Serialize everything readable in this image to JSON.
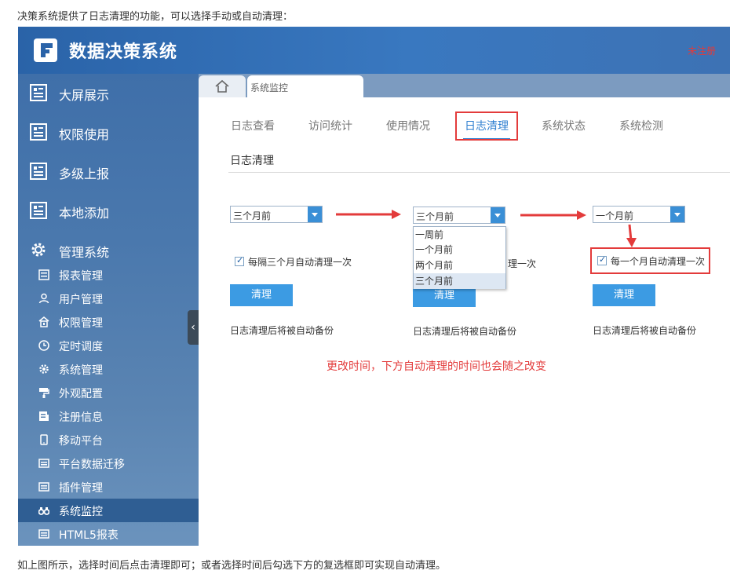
{
  "captions": {
    "top": "决策系统提供了日志清理的功能，可以选择手动或自动清理：",
    "bottom": "如上图所示，选择时间后点击清理即可；或者选择时间后勾选下方的复选框即可实现自动清理。"
  },
  "header": {
    "title": "数据决策系统",
    "unregistered": "未注册"
  },
  "sidebar": {
    "main_items": [
      {
        "label": "大屏展示",
        "icon": "dashboard-icon"
      },
      {
        "label": "权限使用",
        "icon": "dashboard-icon"
      },
      {
        "label": "多级上报",
        "icon": "dashboard-icon"
      },
      {
        "label": "本地添加",
        "icon": "dashboard-icon"
      },
      {
        "label": "管理系统",
        "icon": "gear-icon"
      }
    ],
    "sub_items": [
      {
        "label": "报表管理",
        "icon": "report-icon"
      },
      {
        "label": "用户管理",
        "icon": "user-icon"
      },
      {
        "label": "权限管理",
        "icon": "lock-icon"
      },
      {
        "label": "定时调度",
        "icon": "clock-icon"
      },
      {
        "label": "系统管理",
        "icon": "gear-icon"
      },
      {
        "label": "外观配置",
        "icon": "paint-roller-icon"
      },
      {
        "label": "注册信息",
        "icon": "register-icon"
      },
      {
        "label": "移动平台",
        "icon": "mobile-icon"
      },
      {
        "label": "平台数据迁移",
        "icon": "migrate-icon"
      },
      {
        "label": "插件管理",
        "icon": "plugin-icon"
      },
      {
        "label": "系统监控",
        "icon": "binoculars-icon"
      },
      {
        "label": "HTML5报表",
        "icon": "html5-icon"
      }
    ],
    "active_sub": "系统监控",
    "collapse_glyph": "‹"
  },
  "tabstrip": {
    "page_tab": "系统监控"
  },
  "subnav": {
    "tabs": [
      "日志查看",
      "访问统计",
      "使用情况",
      "日志清理",
      "系统状态",
      "系统检测"
    ],
    "active": "日志清理"
  },
  "section": {
    "title": "日志清理"
  },
  "panels": {
    "panel1": {
      "select": "三个月前",
      "checkbox": "每隔三个月自动清理一次",
      "button": "清理",
      "note": "日志清理后将被自动备份"
    },
    "panel2": {
      "select": "三个月前",
      "checkbox_tail": "理一次",
      "button": "清理",
      "note": "日志清理后将被自动备份",
      "options": [
        "一周前",
        "一个月前",
        "两个月前",
        "三个月前"
      ]
    },
    "panel3": {
      "select": "一个月前",
      "checkbox": "每一个月自动清理一次",
      "button": "清理",
      "note": "日志清理后将被自动备份"
    }
  },
  "annotation": {
    "note": "更改时间，下方自动清理的时间也会随之改变",
    "color": "#e33b3b"
  }
}
